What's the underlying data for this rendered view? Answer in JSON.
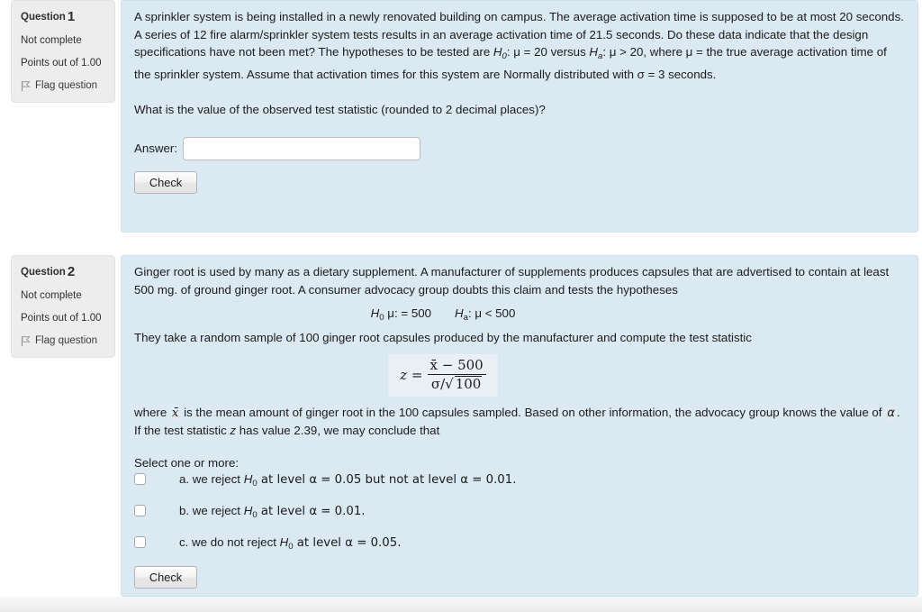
{
  "questions": [
    {
      "header_label": "Question",
      "number": "1",
      "status": "Not complete",
      "points": "Points out of 1.00",
      "flag_label": "Flag question",
      "body_part1": "A sprinkler system is being installed in a newly renovated building on campus. The average activation time is supposed to be at most 20 seconds. A series of 12 fire alarm/sprinkler system tests results in an average activation time of 21.5 seconds. Do these data indicate that the design specifications have not been met? The hypotheses to be tested are ",
      "h0": "H",
      "h0_sub": "0",
      "h0_rest": ": μ = 20 versus ",
      "ha": "H",
      "ha_sub": "a",
      "ha_rest": ": μ > 20, where μ = the true average activation time of the sprinkler system. Assume that activation times for this system are Normally distributed with σ = 3 seconds.",
      "prompt": "What is the value of the observed test statistic (rounded to 2 decimal places)?",
      "answer_label": "Answer:",
      "answer_value": "",
      "answer_placeholder": "",
      "check_label": "Check"
    },
    {
      "header_label": "Question",
      "number": "2",
      "status": "Not complete",
      "points": "Points out of 1.00",
      "flag_label": "Flag question",
      "body_part1": "Ginger root is used by many as a dietary supplement. A manufacturer of supplements produces capsules that are advertised to contain at least 500 mg. of ground ginger root. A consumer advocacy group doubts this claim and tests the hypotheses",
      "hyp_h0": "H",
      "hyp_h0_sub": "0",
      "hyp_h0_rest": " μ: = 500",
      "hyp_ha": "H",
      "hyp_ha_sub": "a",
      "hyp_ha_rest": ": μ < 500",
      "body_part2": "They take a random sample of 100 ginger root capsules produced by the manufacturer and compute the test statistic",
      "formula": {
        "lhs": "z =",
        "numerator": "x̄ − 500",
        "denominator_sigma": "σ/",
        "denominator_radicand": "100"
      },
      "body_part3_a": "where ",
      "body_part3_xbar": "x̄",
      "body_part3_b": " is the mean amount of ginger root in the 100 capsules sampled. Based on other information, the advocacy group knows the value of ",
      "body_part3_alpha": "α",
      "body_part3_c": ". If the test statistic ",
      "body_part3_z": "z",
      "body_part3_d": " has value 2.39, we may conclude that",
      "select_prompt": "Select one or more:",
      "options": [
        {
          "letter": "a.",
          "pre": " we reject ",
          "h": "H",
          "h_sub": "0",
          "post": " at level α = 0.05 but not at level α = 0.01.",
          "checked": false
        },
        {
          "letter": "b.",
          "pre": " we reject ",
          "h": "H",
          "h_sub": "0",
          "post": " at level α = 0.01.",
          "checked": false
        },
        {
          "letter": "c.",
          "pre": " we do not reject ",
          "h": "H",
          "h_sub": "0",
          "post": " at level α = 0.05.",
          "checked": false
        }
      ],
      "check_label": "Check"
    }
  ],
  "colors": {
    "content_bg": "#dbe9f3",
    "info_bg": "#ededed",
    "page_bg": "#ffffff"
  }
}
